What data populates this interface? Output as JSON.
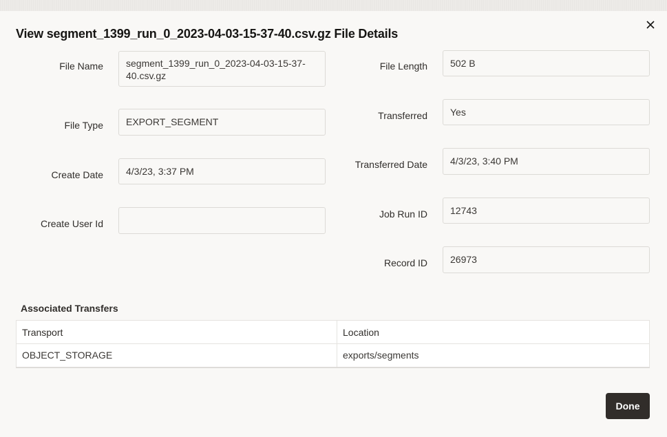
{
  "dialog": {
    "title": "View segment_1399_run_0_2023-04-03-15-37-40.csv.gz File Details",
    "close_icon": "close-icon",
    "done_label": "Done"
  },
  "fields_left": [
    {
      "label": "File Name",
      "value": "segment_1399_run_0_2023-04-03-15-37-40.csv.gz"
    },
    {
      "label": "File Type",
      "value": "EXPORT_SEGMENT"
    },
    {
      "label": "Create Date",
      "value": "4/3/23, 3:37 PM"
    },
    {
      "label": "Create User Id",
      "value": ""
    }
  ],
  "fields_right": [
    {
      "label": "File Length",
      "value": "502 B"
    },
    {
      "label": "Transferred",
      "value": "Yes"
    },
    {
      "label": "Transferred Date",
      "value": "4/3/23, 3:40 PM"
    },
    {
      "label": "Job Run ID",
      "value": "12743"
    },
    {
      "label": "Record ID",
      "value": "26973"
    }
  ],
  "transfers": {
    "title": "Associated Transfers",
    "columns": [
      "Transport",
      "Location"
    ],
    "rows": [
      [
        "OBJECT_STORAGE",
        "exports/segments"
      ]
    ]
  }
}
